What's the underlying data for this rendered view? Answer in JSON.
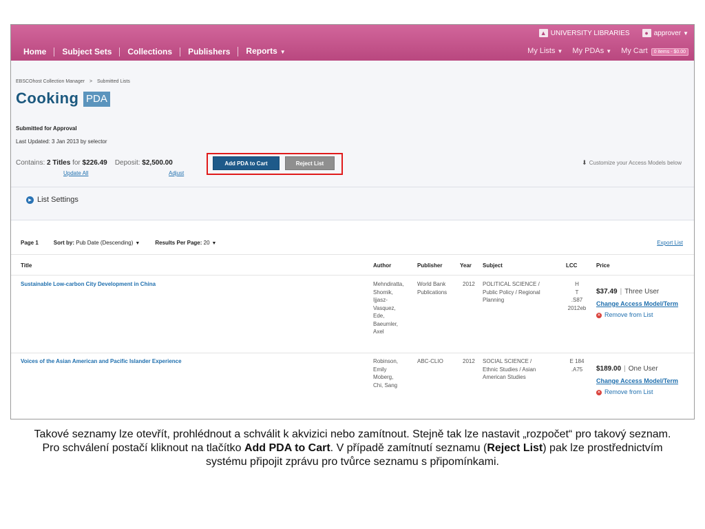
{
  "utility": {
    "library_label": "UNIVERSITY LIBRARIES",
    "user_label": "approver",
    "library_icon": "bank-icon",
    "user_icon": "person-icon"
  },
  "nav": {
    "items": [
      "Home",
      "Subject Sets",
      "Collections",
      "Publishers",
      "Reports"
    ],
    "right": {
      "my_lists": "My Lists",
      "my_pdas": "My PDAs",
      "my_cart": "My Cart",
      "cart_badge": "0 items - $0.00"
    }
  },
  "header": {
    "breadcrumb": [
      "EBSCOhost Collection Manager",
      "Submitted Lists"
    ],
    "breadcrumb_sep": ">",
    "title": "Cooking",
    "badge": "PDA",
    "status": "Submitted for Approval",
    "last_updated": "Last Updated: 3 Jan 2013 by selector",
    "contains_label": "Contains:",
    "titles_count": "2 Titles",
    "for_label": "for",
    "total": "$226.49",
    "deposit_label": "Deposit:",
    "deposit": "$2,500.00",
    "update_all": "Update All",
    "adjust": "Adjust",
    "add_pda_button": "Add PDA to Cart",
    "reject_button": "Reject List",
    "customize_hint": "Customize your Access Models below",
    "list_settings": "List Settings"
  },
  "controls": {
    "page": "Page 1",
    "sort_label": "Sort by:",
    "sort_value": "Pub Date (Descending)",
    "per_page_label": "Results Per Page:",
    "per_page_value": "20",
    "export": "Export List"
  },
  "table": {
    "columns": [
      "Title",
      "Author",
      "Publisher",
      "Year",
      "Subject",
      "LCC",
      "Price"
    ],
    "rows": [
      {
        "title": "Sustainable Low-carbon City Development in China",
        "author": [
          "Mehndiratta,",
          "Shomik,",
          "Ijjasz-",
          "Vasquez,",
          "Ede,",
          "Baeumler,",
          "Axel"
        ],
        "publisher": [
          "World Bank",
          "Publications"
        ],
        "year": "2012",
        "subject": [
          "POLITICAL SCIENCE /",
          "Public Policy / Regional",
          "Planning"
        ],
        "lcc": [
          "H",
          "T",
          ".S87",
          "2012eb"
        ],
        "price": "$37.49",
        "license": "Three User",
        "change_link": "Change Access Model/Term",
        "remove_link": "Remove from List"
      },
      {
        "title": "Voices of the Asian American and Pacific Islander Experience",
        "author": [
          "Robinson,",
          "Emily",
          "Moberg,",
          "Chi, Sang"
        ],
        "publisher": [
          "ABC-CLIO"
        ],
        "year": "2012",
        "subject": [
          "SOCIAL SCIENCE /",
          "Ethnic Studies / Asian",
          "American Studies"
        ],
        "lcc": [
          "E 184",
          ".A75"
        ],
        "price": "$189.00",
        "license": "One User",
        "change_link": "Change Access Model/Term",
        "remove_link": "Remove from List"
      }
    ]
  },
  "caption": {
    "part1": "Takové seznamy lze otevřít, prohlédnout a schválit k akvizici nebo zamítnout. Stejně tak lze nastavit „rozpočet“ pro takový seznam. Pro schválení postačí kliknout na tlačítko ",
    "bold1": "Add PDA to Cart",
    "part2": ". V případě zamítnutí seznamu (",
    "bold2": "Reject List",
    "part3": ") pak lze prostřednictvím systému připojit zprávu pro tvůrce seznamu s připomínkami."
  },
  "colors": {
    "nav_bar": "#c44e8a",
    "link": "#1f6fae",
    "title": "#1b587e",
    "primary_button": "#1e5a8a",
    "highlight": "#e01a1a"
  }
}
